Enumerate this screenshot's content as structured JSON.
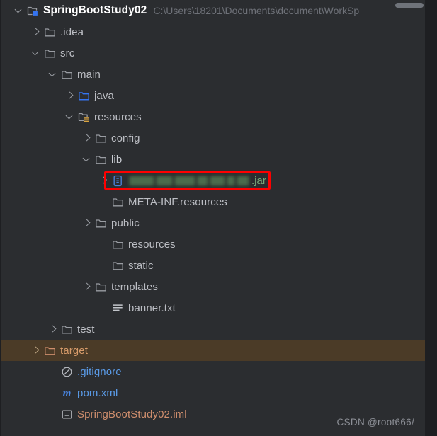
{
  "window": {
    "background": "#2b2d30",
    "selection_color": "#35538f",
    "excluded_color": "#4b3b27",
    "redaction_border_color": "#ff0000"
  },
  "scrollbar": {
    "name": "horizontal-scrollbar"
  },
  "watermark": {
    "text": "CSDN @root666/"
  },
  "tree": {
    "rows": [
      {
        "label": "SpringBootStudy02",
        "path": "C:\\Users\\18201\\Documents\\document\\WorkSp",
        "icon": "module-folder-icon",
        "arrow": "chevron-down-icon",
        "depth": 0,
        "style": "root"
      },
      {
        "label": ".idea",
        "icon": "folder-icon",
        "arrow": "chevron-right-icon",
        "depth": 1,
        "style": "normal"
      },
      {
        "label": "src",
        "icon": "folder-icon",
        "arrow": "chevron-down-icon",
        "depth": 1,
        "style": "normal"
      },
      {
        "label": "main",
        "icon": "folder-icon",
        "arrow": "chevron-down-icon",
        "depth": 2,
        "style": "normal"
      },
      {
        "label": "java",
        "icon": "source-root-folder-icon",
        "arrow": "chevron-right-icon",
        "depth": 3,
        "style": "normal"
      },
      {
        "label": "resources",
        "icon": "resource-root-folder-icon",
        "arrow": "chevron-down-icon",
        "depth": 3,
        "style": "normal"
      },
      {
        "label": "config",
        "icon": "folder-icon",
        "arrow": "chevron-right-icon",
        "depth": 4,
        "style": "normal"
      },
      {
        "label": "lib",
        "icon": "folder-icon",
        "arrow": "chevron-down-icon",
        "depth": 4,
        "style": "selected"
      },
      {
        "label": ".jar",
        "icon": "jar-archive-icon",
        "arrow": "chevron-right-icon",
        "depth": 5,
        "style": "redacted-jar",
        "redacted": true
      },
      {
        "label": "META-INF.resources",
        "icon": "folder-icon",
        "arrow": "none",
        "depth": 5,
        "style": "normal"
      },
      {
        "label": "public",
        "icon": "folder-icon",
        "arrow": "chevron-right-icon",
        "depth": 4,
        "style": "normal"
      },
      {
        "label": "resources",
        "icon": "folder-icon",
        "arrow": "none",
        "depth": 5,
        "style": "normal"
      },
      {
        "label": "static",
        "icon": "folder-icon",
        "arrow": "none",
        "depth": 5,
        "style": "normal"
      },
      {
        "label": "templates",
        "icon": "folder-icon",
        "arrow": "chevron-right-icon",
        "depth": 4,
        "style": "normal"
      },
      {
        "label": "banner.txt",
        "icon": "text-file-icon",
        "arrow": "none",
        "depth": 5,
        "style": "normal"
      },
      {
        "label": "test",
        "icon": "folder-icon",
        "arrow": "chevron-right-icon",
        "depth": 2,
        "style": "normal"
      },
      {
        "label": "target",
        "icon": "excluded-folder-icon",
        "arrow": "chevron-right-icon",
        "depth": 1,
        "style": "excluded"
      },
      {
        "label": ".gitignore",
        "icon": "gitignore-icon",
        "arrow": "none",
        "depth": 2,
        "style": "blue"
      },
      {
        "label": "pom.xml",
        "icon": "maven-icon",
        "arrow": "none",
        "depth": 2,
        "style": "blue"
      },
      {
        "label": "SpringBootStudy02.iml",
        "icon": "iml-file-icon",
        "arrow": "none",
        "depth": 2,
        "style": "orange"
      }
    ]
  }
}
